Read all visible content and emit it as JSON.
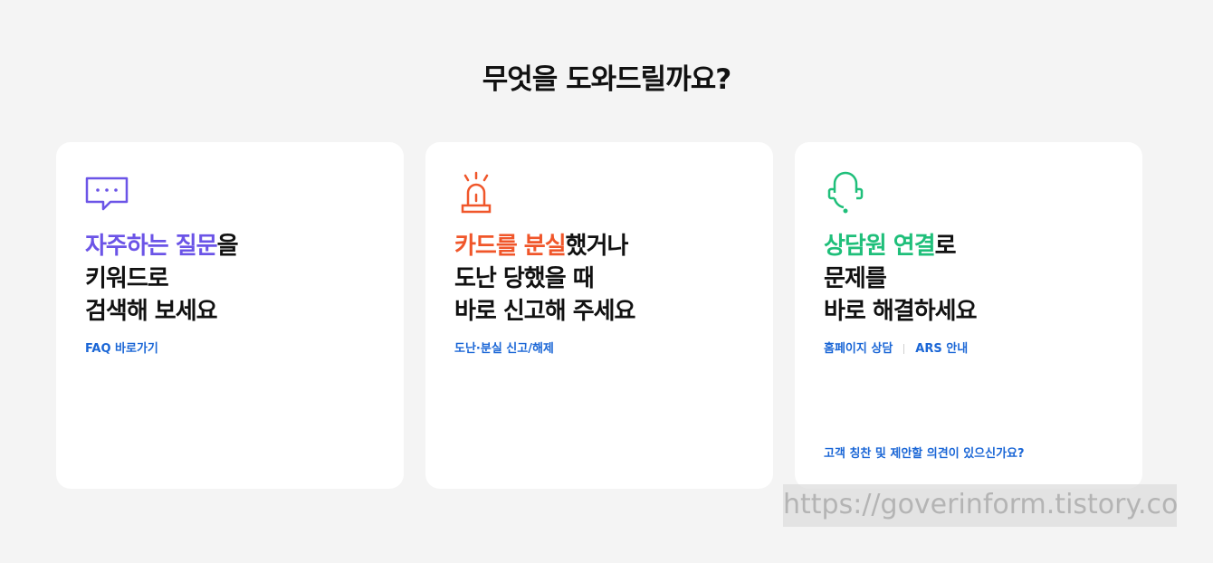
{
  "title": "무엇을 도와드릴까요?",
  "colors": {
    "purple": "#6b54e7",
    "orange": "#f0562a",
    "green": "#1fbf7a",
    "link": "#1a66d6"
  },
  "cards": [
    {
      "icon": "chat-bubble-icon",
      "headline": {
        "hl": "자주하는 질문",
        "rest": "을",
        "line2": "키워드로",
        "line3": "검색해 보세요"
      },
      "links": [
        "FAQ 바로가기"
      ]
    },
    {
      "icon": "siren-icon",
      "headline": {
        "hl": "카드를 분실",
        "rest": "했거나",
        "line2": "도난 당했을 때",
        "line3": "바로 신고해 주세요"
      },
      "links": [
        "도난·분실 신고/해제"
      ]
    },
    {
      "icon": "headset-icon",
      "headline": {
        "hl": "상담원 연결",
        "rest": "로",
        "line2": "문제를",
        "line3": "바로 해결하세요"
      },
      "links": [
        "홈페이지 상담",
        "ARS 안내"
      ],
      "bottom_link": "고객 칭찬 및 제안할 의견이 있으신가요?"
    }
  ],
  "watermark": "https://goverinform.tistory.com"
}
